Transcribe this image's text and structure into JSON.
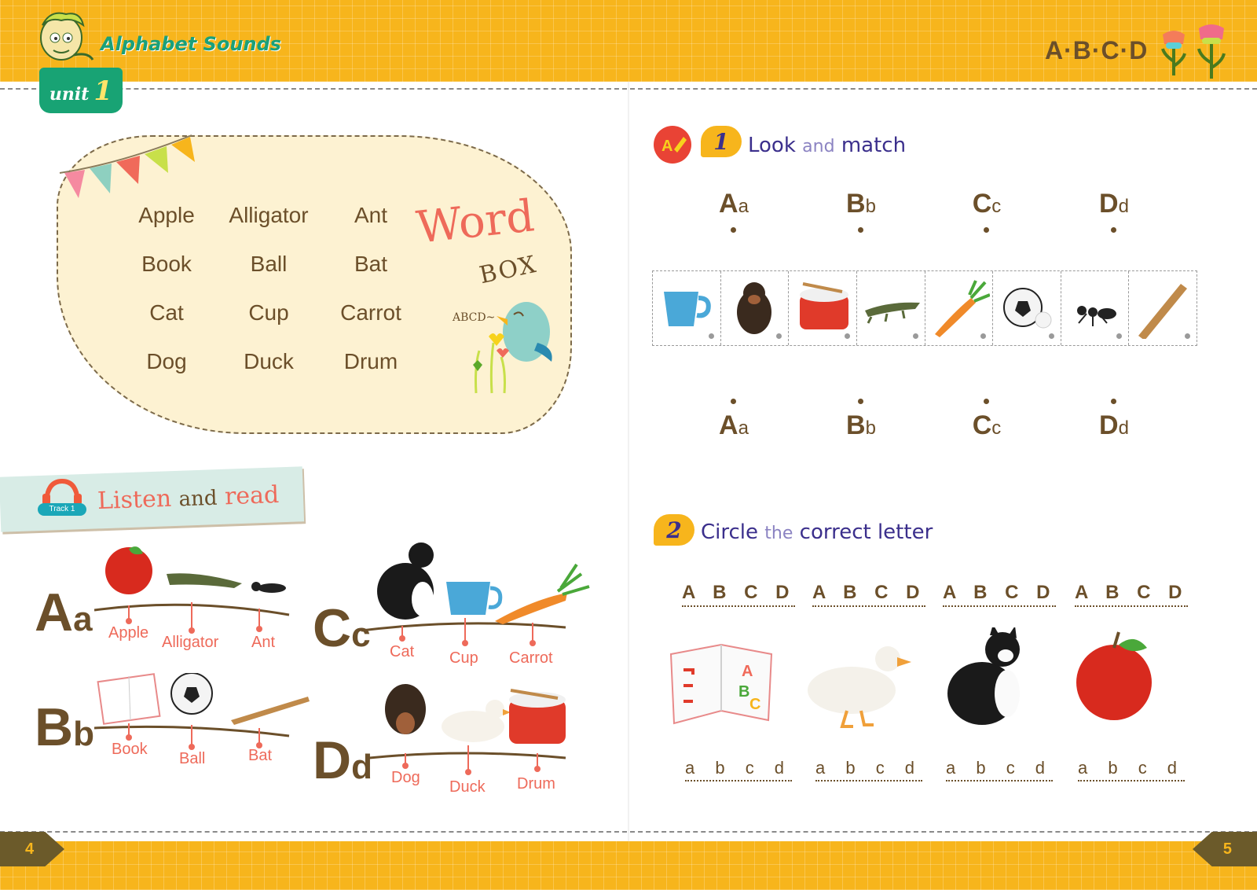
{
  "header": {
    "series_title": "Alphabet Sounds",
    "unit_word": "unit",
    "unit_number": "1",
    "letters": "A·B·C·D"
  },
  "pages": {
    "left": "4",
    "right": "5"
  },
  "word_box": {
    "title_word": "Word",
    "title_box": "BOX",
    "bird_caption": "ABCD~",
    "words": [
      "Apple",
      "Alligator",
      "Ant",
      "Book",
      "Ball",
      "Bat",
      "Cat",
      "Cup",
      "Carrot",
      "Dog",
      "Duck",
      "Drum"
    ]
  },
  "listen": {
    "track": "Track 1",
    "title_1": "Listen",
    "title_and": "and",
    "title_2": "read",
    "groups": [
      {
        "upper": "A",
        "lower": "a",
        "words": [
          "Apple",
          "Alligator",
          "Ant"
        ]
      },
      {
        "upper": "B",
        "lower": "b",
        "words": [
          "Book",
          "Ball",
          "Bat"
        ]
      },
      {
        "upper": "C",
        "lower": "c",
        "words": [
          "Cat",
          "Cup",
          "Carrot"
        ]
      },
      {
        "upper": "D",
        "lower": "d",
        "words": [
          "Dog",
          "Duck",
          "Drum"
        ]
      }
    ]
  },
  "activity1": {
    "number": "1",
    "title_1": "Look",
    "title_and": "and",
    "title_2": "match",
    "letters": [
      {
        "upper": "A",
        "lower": "a"
      },
      {
        "upper": "B",
        "lower": "b"
      },
      {
        "upper": "C",
        "lower": "c"
      },
      {
        "upper": "D",
        "lower": "d"
      }
    ],
    "pictures": [
      "cup-image",
      "dog-image",
      "drum-image",
      "alligator-image",
      "carrot-image",
      "ball-image",
      "ant-image",
      "bat-image"
    ]
  },
  "activity2": {
    "number": "2",
    "title_1": "Circle",
    "title_the": "the",
    "title_2": "correct letter",
    "upper_choices": "A B C D",
    "lower_choices": "a b c d",
    "pictures": [
      "book-image",
      "duck-image",
      "cat-image",
      "apple-image"
    ]
  },
  "colors": {
    "band": "#f7b51c",
    "brown": "#6b4f2a",
    "coral": "#ee6a5a",
    "green": "#18a374",
    "purple": "#3b2f8c"
  }
}
